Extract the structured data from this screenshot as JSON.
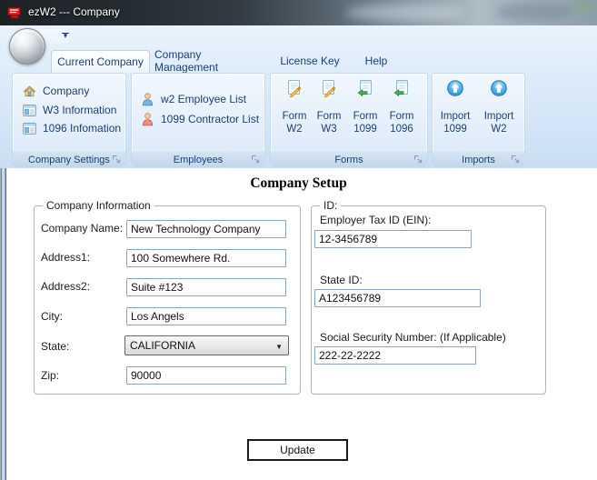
{
  "window": {
    "title": "ezW2 --- Company",
    "icon": "ezw2-logo-icon"
  },
  "tabs": [
    {
      "label": "Current Company"
    },
    {
      "label": "Company Management"
    },
    {
      "label": "License Key"
    },
    {
      "label": "Help"
    }
  ],
  "ribbon": {
    "company_settings": {
      "label": "Company Settings",
      "items": [
        {
          "label": "Company",
          "icon": "home-icon"
        },
        {
          "label": "W3 Information",
          "icon": "form-window-icon"
        },
        {
          "label": "1096 Infomation",
          "icon": "form-window-icon"
        }
      ]
    },
    "employees": {
      "label": "Employees",
      "items": [
        {
          "label": "w2 Employee List",
          "icon": "person-blue-icon"
        },
        {
          "label": "1099 Contractor List",
          "icon": "person-red-icon"
        }
      ]
    },
    "forms": {
      "label": "Forms",
      "items": [
        {
          "line1": "Form",
          "line2": "W2",
          "icon": "document-edit-icon"
        },
        {
          "line1": "Form",
          "line2": "W3",
          "icon": "document-edit-icon"
        },
        {
          "line1": "Form",
          "line2": "1099",
          "icon": "document-arrow-icon"
        },
        {
          "line1": "Form",
          "line2": "1096",
          "icon": "document-arrow-icon"
        }
      ]
    },
    "imports": {
      "label": "Imports",
      "items": [
        {
          "line1": "Import",
          "line2": "1099",
          "icon": "import-up-icon"
        },
        {
          "line1": "Import",
          "line2": "W2",
          "icon": "import-up-icon"
        }
      ]
    }
  },
  "content": {
    "heading": "Company Setup",
    "company_info": {
      "legend": "Company Information",
      "fields": [
        {
          "label": "Company Name:",
          "value": "New Technology Company"
        },
        {
          "label": "Address1:",
          "value": "100 Somewhere Rd."
        },
        {
          "label": "Address2:",
          "value": "Suite #123"
        },
        {
          "label": "City:",
          "value": "Los Angels"
        },
        {
          "label": "State:",
          "value": "CALIFORNIA",
          "control": "dropdown"
        },
        {
          "label": "Zip:",
          "value": "90000"
        }
      ]
    },
    "ids": {
      "legend": "ID:",
      "fields": [
        {
          "label": "Employer Tax ID (EIN):",
          "value": "12-3456789"
        },
        {
          "label": "State ID:",
          "value": "A123456789"
        },
        {
          "label": "Social Security Number: (If Applicable)",
          "value": "222-22-2222"
        }
      ]
    },
    "update_label": "Update"
  },
  "colors": {
    "ribbon_text": "#1b3f77",
    "ribbon_background": "#d9e9f8",
    "title_icon_red": "#e02222",
    "active_tab": "#ffffff",
    "import_icon_blue": "#2e9be0",
    "contractor_icon_red": "#ef8e85",
    "employee_icon_blue": "#74b9ea"
  }
}
